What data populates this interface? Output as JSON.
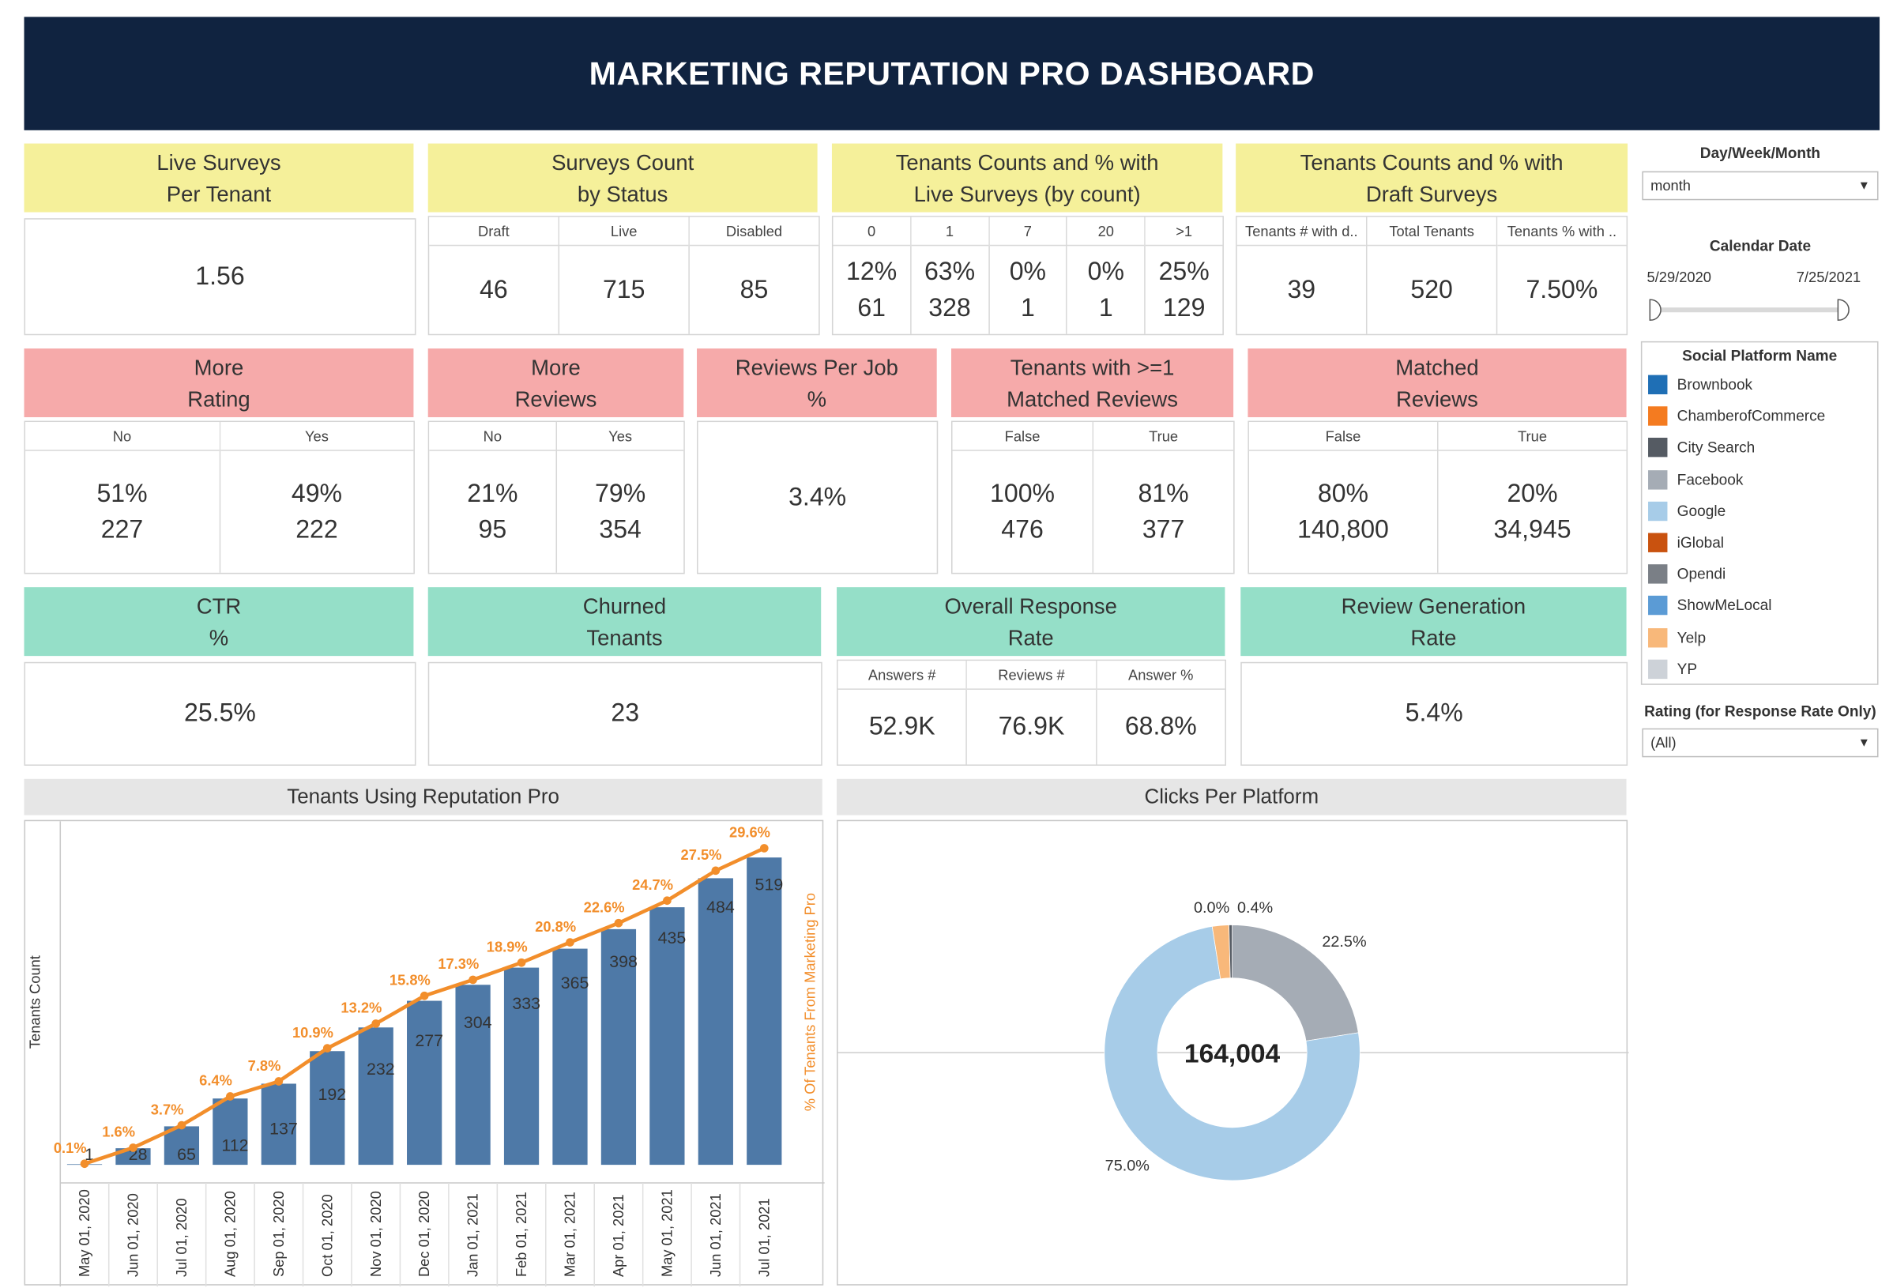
{
  "title": "MARKETING REPUTATION PRO DASHBOARD",
  "kpi_row1": {
    "live_surveys": {
      "header": "Live Surveys\nPer Tenant",
      "value": "1.56"
    },
    "surveys_count": {
      "header": "Surveys Count\nby Status",
      "columns": [
        {
          "label": "Draft",
          "value": "46"
        },
        {
          "label": "Live",
          "value": "715"
        },
        {
          "label": "Disabled",
          "value": "85"
        }
      ]
    },
    "tenants_live": {
      "header": "Tenants Counts and % with\nLive Surveys (by count)",
      "columns": [
        {
          "label": "0",
          "pct": "12%",
          "count": "61"
        },
        {
          "label": "1",
          "pct": "63%",
          "count": "328"
        },
        {
          "label": "7",
          "pct": "0%",
          "count": "1"
        },
        {
          "label": "20",
          "pct": "0%",
          "count": "1"
        },
        {
          "label": ">1",
          "pct": "25%",
          "count": "129"
        }
      ]
    },
    "tenants_draft": {
      "header": "Tenants Counts and % with\nDraft Surveys",
      "columns": [
        {
          "label": "Tenants # with d..",
          "value": "39"
        },
        {
          "label": "Total Tenants",
          "value": "520"
        },
        {
          "label": "Tenants % with ..",
          "value": "7.50%"
        }
      ]
    }
  },
  "kpi_row2": {
    "more_rating": {
      "header": "More\nRating",
      "columns": [
        {
          "label": "No",
          "pct": "51%",
          "count": "227"
        },
        {
          "label": "Yes",
          "pct": "49%",
          "count": "222"
        }
      ]
    },
    "more_reviews": {
      "header": "More\nReviews",
      "columns": [
        {
          "label": "No",
          "pct": "21%",
          "count": "95"
        },
        {
          "label": "Yes",
          "pct": "79%",
          "count": "354"
        }
      ]
    },
    "reviews_per_job": {
      "header": "Reviews Per Job\n%",
      "value": "3.4%"
    },
    "tenants_matched": {
      "header": "Tenants with >=1\nMatched Reviews",
      "columns": [
        {
          "label": "False",
          "pct": "100%",
          "count": "476"
        },
        {
          "label": "True",
          "pct": "81%",
          "count": "377"
        }
      ]
    },
    "matched_reviews": {
      "header": "Matched\nReviews",
      "columns": [
        {
          "label": "False",
          "pct": "80%",
          "count": "140,800"
        },
        {
          "label": "True",
          "pct": "20%",
          "count": "34,945"
        }
      ]
    }
  },
  "kpi_row3": {
    "ctr": {
      "header": "CTR\n%",
      "value": "25.5%"
    },
    "churned": {
      "header": "Churned\nTenants",
      "value": "23"
    },
    "response_rate": {
      "header": "Overall Response\nRate",
      "columns": [
        {
          "label": "Answers #",
          "value": "52.9K"
        },
        {
          "label": "Reviews #",
          "value": "76.9K"
        },
        {
          "label": "Answer %",
          "value": "68.8%"
        }
      ]
    },
    "review_gen": {
      "header": "Review Generation\nRate",
      "value": "5.4%"
    }
  },
  "filters": {
    "period_label": "Day/Week/Month",
    "period_value": "month",
    "date_label": "Calendar Date",
    "date_start": "5/29/2020",
    "date_end": "7/25/2021",
    "legend_title": "Social Platform Name",
    "platforms": [
      {
        "name": "Brownbook",
        "color": "#1f6fb5"
      },
      {
        "name": "ChamberofCommerce",
        "color": "#f47b20"
      },
      {
        "name": "City Search",
        "color": "#555b63"
      },
      {
        "name": "Facebook",
        "color": "#a5acb5"
      },
      {
        "name": "Google",
        "color": "#a7cce8"
      },
      {
        "name": "iGlobal",
        "color": "#c9520f"
      },
      {
        "name": "Opendi",
        "color": "#7a7f86"
      },
      {
        "name": "ShowMeLocal",
        "color": "#5b9bd5"
      },
      {
        "name": "Yelp",
        "color": "#f8b87a"
      },
      {
        "name": "YP",
        "color": "#cdd2d8"
      }
    ],
    "rating_label": "Rating (for Response Rate Only)",
    "rating_value": "(All)"
  },
  "chart_data": [
    {
      "type": "bar",
      "title": "Tenants Using Reputation Pro",
      "ylabel": "Tenants Count",
      "y2label": "% Of Tenants From Marketing Pro",
      "categories": [
        "May 01, 2020",
        "Jun 01, 2020",
        "Jul 01, 2020",
        "Aug 01, 2020",
        "Sep 01, 2020",
        "Oct 01, 2020",
        "Nov 01, 2020",
        "Dec 01, 2020",
        "Jan 01, 2021",
        "Feb 01, 2021",
        "Mar 01, 2021",
        "Apr 01, 2021",
        "May 01, 2021",
        "Jun 01, 2021",
        "Jul 01, 2021"
      ],
      "series": [
        {
          "name": "Tenants Count",
          "type": "bar",
          "color": "#4e79a7",
          "values": [
            1,
            28,
            65,
            112,
            137,
            192,
            232,
            277,
            304,
            333,
            365,
            398,
            435,
            484,
            519
          ]
        },
        {
          "name": "% Of Tenants From Marketing Pro",
          "type": "line",
          "color": "#f28e2b",
          "values": [
            0.1,
            1.6,
            3.7,
            6.4,
            7.8,
            10.9,
            13.2,
            15.8,
            17.3,
            18.9,
            20.8,
            22.6,
            24.7,
            27.5,
            29.6
          ],
          "labels": [
            "0.1%",
            "1.6%",
            "3.7%",
            "6.4%",
            "7.8%",
            "10.9%",
            "13.2%",
            "15.8%",
            "17.3%",
            "18.9%",
            "20.8%",
            "22.6%",
            "24.7%",
            "27.5%",
            "29.6%"
          ]
        }
      ]
    },
    {
      "type": "pie",
      "title": "Clicks Per Platform",
      "center_label": "164,004",
      "slices": [
        {
          "name": "Facebook",
          "value": 22.5,
          "label": "22.5%",
          "color": "#a5acb5"
        },
        {
          "name": "Google",
          "value": 75.0,
          "label": "75.0%",
          "color": "#a7cce8"
        },
        {
          "name": "Yelp",
          "value": 2.1,
          "label": "",
          "color": "#f8b87a"
        },
        {
          "name": "City Search",
          "value": 0.4,
          "label": "0.4%",
          "color": "#555b63"
        },
        {
          "name": "Opendi",
          "value": 0.0,
          "label": "0.0%",
          "color": "#7a7f86"
        }
      ]
    }
  ]
}
